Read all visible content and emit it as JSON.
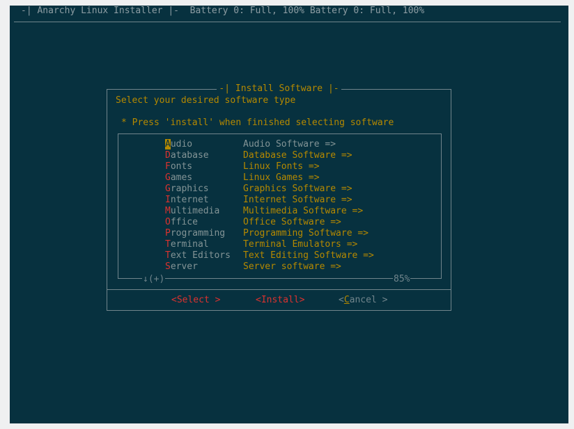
{
  "header": {
    "status_line": "-| Anarchy Linux Installer |-  Battery 0: Full, 100% Battery 0: Full, 100%"
  },
  "dialog": {
    "title": "-| Install Software |-",
    "prompt": "Select your desired software type",
    "hint": "* Press 'install' when finished selecting software",
    "selected_index": 0,
    "items": [
      {
        "tag_first": "A",
        "tag_rest": "udio",
        "description": "Audio Software =>"
      },
      {
        "tag_first": "D",
        "tag_rest": "atabase",
        "description": "Database Software =>"
      },
      {
        "tag_first": "F",
        "tag_rest": "onts",
        "description": "Linux Fonts =>"
      },
      {
        "tag_first": "G",
        "tag_rest": "ames",
        "description": "Linux Games =>"
      },
      {
        "tag_first": "G",
        "tag_rest": "raphics",
        "description": "Graphics Software =>"
      },
      {
        "tag_first": "I",
        "tag_rest": "nternet",
        "description": "Internet Software =>"
      },
      {
        "tag_first": "M",
        "tag_rest": "ultimedia",
        "description": "Multimedia Software =>"
      },
      {
        "tag_first": "O",
        "tag_rest": "ffice",
        "description": "Office Software =>"
      },
      {
        "tag_first": "P",
        "tag_rest": "rogramming",
        "description": "Programming Software =>"
      },
      {
        "tag_first": "T",
        "tag_rest": "erminal",
        "description": "Terminal Emulators =>"
      },
      {
        "tag_first": "T",
        "tag_rest": "ext Editors",
        "description": "Text Editing Software =>"
      },
      {
        "tag_first": "S",
        "tag_rest": "erver",
        "description": "Server software =>"
      }
    ],
    "scroll_indicator": "↓(+)",
    "scroll_percent": "85%",
    "buttons": {
      "select": "<Select >",
      "install": "<Install>",
      "cancel_open": "<",
      "cancel_hot": "C",
      "cancel_rest": "ancel >"
    }
  },
  "colors": {
    "background": "#07313f",
    "accent": "#b58900",
    "hotkey": "#dc322f",
    "text": "#839496",
    "border": "#71858c"
  }
}
